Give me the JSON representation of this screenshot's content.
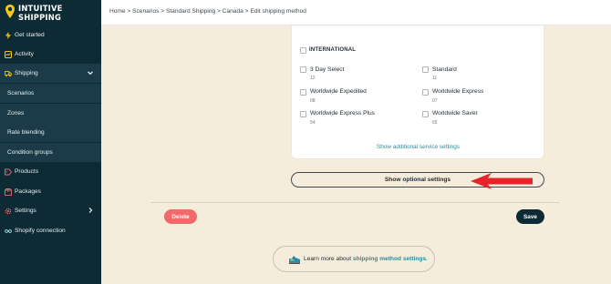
{
  "brand": {
    "line1": "INTUITIVE",
    "line2": "SHIPPING"
  },
  "breadcrumb": "Home > Scenarios > Standard Shipping > Canada > Edit shipping method",
  "sidebar": {
    "items": [
      {
        "label": "Get started",
        "icon": "bolt-icon"
      },
      {
        "label": "Activity",
        "icon": "activity-icon"
      },
      {
        "label": "Shipping",
        "icon": "truck-icon"
      },
      {
        "label": "Scenarios"
      },
      {
        "label": "Zones"
      },
      {
        "label": "Rate blending"
      },
      {
        "label": "Condition groups"
      },
      {
        "label": "Products",
        "icon": "tag-icon"
      },
      {
        "label": "Packages",
        "icon": "package-icon"
      },
      {
        "label": "Settings",
        "icon": "gear-icon"
      },
      {
        "label": "Shopify connection",
        "icon": "shopify-icon"
      }
    ]
  },
  "services": {
    "header": "INTERNATIONAL",
    "items": [
      {
        "label": "3 Day Select",
        "code": "12"
      },
      {
        "label": "Standard",
        "code": "11"
      },
      {
        "label": "Worldwide Expedited",
        "code": "08"
      },
      {
        "label": "Worldwide Express",
        "code": "07"
      },
      {
        "label": "Worldwide Express Plus",
        "code": "54"
      },
      {
        "label": "Worldwide Saver",
        "code": "65"
      }
    ],
    "more_link": "Show additional service settings"
  },
  "optional_button": "Show optional settings",
  "actions": {
    "delete": "Delete",
    "save": "Save"
  },
  "learn": {
    "prefix": "Learn more about ",
    "link": "shipping method settings",
    "suffix": "."
  },
  "colors": {
    "sidebar": "#0e2a35",
    "accent": "#2a8d9a",
    "danger": "#f06a6a",
    "arrow": "#e8232a",
    "background": "#f5ecdc"
  }
}
